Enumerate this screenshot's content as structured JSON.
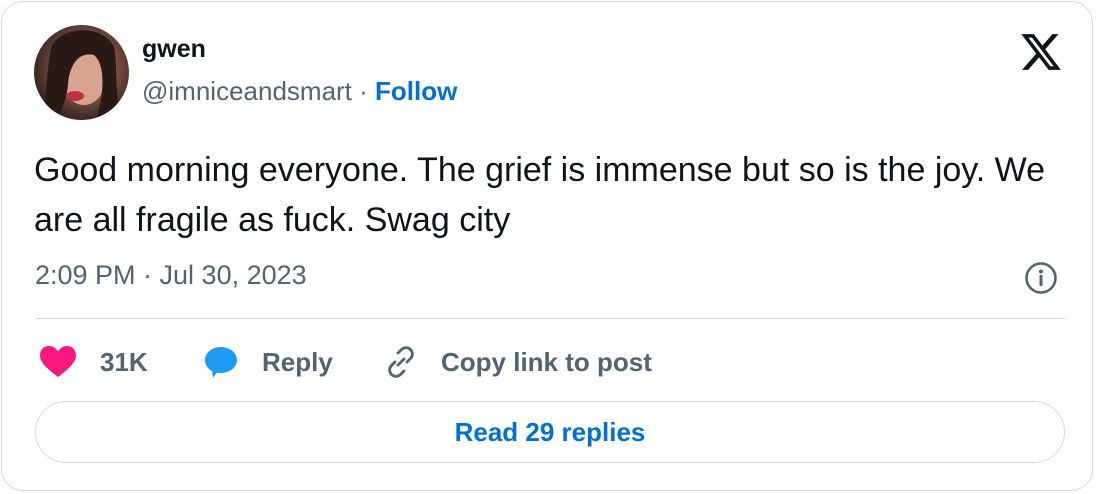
{
  "author": {
    "name": "gwen",
    "handle": "@imniceandsmart",
    "separator": "·",
    "follow_label": "Follow"
  },
  "icons": {
    "brand": "x-logo-icon",
    "info": "info-icon",
    "like": "heart-icon",
    "reply": "speech-bubble-icon",
    "copy": "link-icon"
  },
  "tweet": {
    "text": "Good morning everyone. The grief is immense but so is the joy. We are all fragile as fuck. Swag city",
    "timestamp": "2:09 PM · Jul 30, 2023"
  },
  "actions": {
    "like_count": "31K",
    "reply_label": "Reply",
    "copy_label": "Copy link to post"
  },
  "footer": {
    "read_replies_label": "Read 29 replies"
  },
  "colors": {
    "accent_blue": "#006fd6",
    "heart_pink": "#f91880",
    "reply_blue": "#1d9bf0",
    "secondary_text": "#536471",
    "border": "#cfd9de"
  }
}
